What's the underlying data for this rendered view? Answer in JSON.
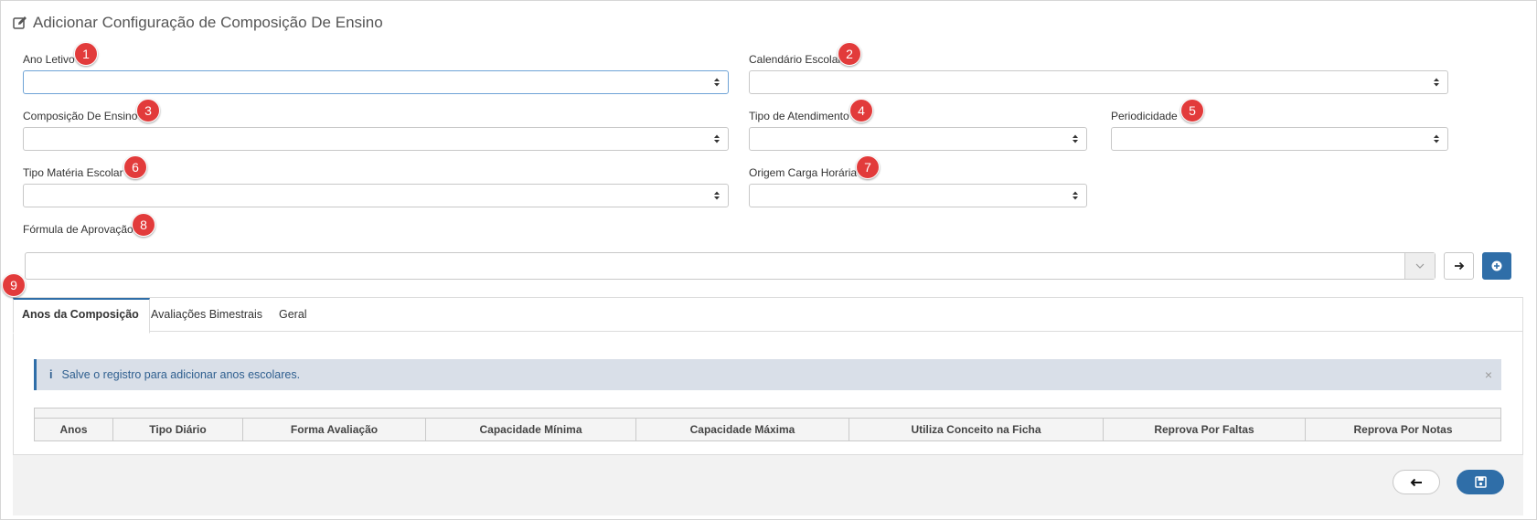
{
  "page": {
    "title": "Adicionar Configuração de Composição De Ensino"
  },
  "fields": {
    "ano_letivo": {
      "label": "Ano Letivo",
      "value": "",
      "badge": "1"
    },
    "calendario_escolar": {
      "label": "Calendário Escolar",
      "value": "",
      "badge": "2"
    },
    "composicao_ensino": {
      "label": "Composição De Ensino",
      "value": "",
      "badge": "3"
    },
    "tipo_atendimento": {
      "label": "Tipo de Atendimento",
      "value": "",
      "badge": "4"
    },
    "periodicidade": {
      "label": "Periodicidade",
      "value": "",
      "badge": "5"
    },
    "tipo_materia_escolar": {
      "label": "Tipo Matéria Escolar",
      "value": "",
      "badge": "6"
    },
    "origem_carga_horaria": {
      "label": "Origem Carga Horária",
      "value": "",
      "badge": "7"
    },
    "formula_aprovacao": {
      "label": "Fórmula de Aprovação",
      "value": "",
      "badge": "8"
    }
  },
  "tabs": {
    "badge": "9",
    "items": [
      {
        "label": "Anos da Composição",
        "active": true
      },
      {
        "label": "Avaliações Bimestrais",
        "active": false
      },
      {
        "label": "Geral",
        "active": false
      }
    ]
  },
  "alert": {
    "message": "Salve o registro para adicionar anos escolares.",
    "icon": "info-icon",
    "close": "×"
  },
  "table": {
    "columns": [
      "Anos",
      "Tipo Diário",
      "Forma Avaliação",
      "Capacidade Mínima",
      "Capacidade Máxima",
      "Utiliza Conceito na Ficha",
      "Reprova Por Faltas",
      "Reprova Por Notas"
    ]
  },
  "colors": {
    "primary": "#2f6ea8",
    "badge": "#e23b3b",
    "alert_bg": "#d9dfe8"
  }
}
